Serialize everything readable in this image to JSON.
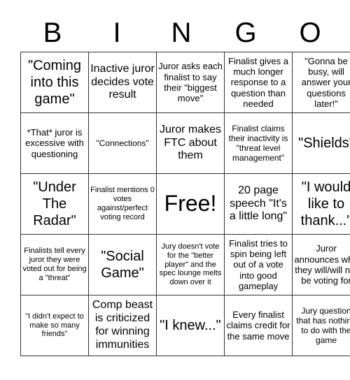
{
  "header": {
    "letters": [
      "B",
      "I",
      "N",
      "G",
      "O"
    ]
  },
  "cells": [
    [
      "\"Coming into this game\"",
      "Inactive juror decides vote result",
      "Juror asks each finalist to say their \"biggest move\"",
      "Finalist gives a much longer response to a question than needed",
      "\"Gonna be busy, will answer your questions later!\""
    ],
    [
      "*That* juror is excessive with questioning",
      "\"Connections\"",
      "Juror makes FTC about them",
      "Finalist claims their inactivity is \"threat level management\"",
      "\"Shields\""
    ],
    [
      "\"Under The Radar\"",
      "Finalist mentions 0 votes against/perfect voting record",
      "Free!",
      "20 page speech \"It's a little long\"",
      "\"I would like to thank...\""
    ],
    [
      "Finalists tell every juror they were voted out for being a \"threat\"",
      "\"Social Game\"",
      "Jury doesn't vote for the \"better player\" and the spec lounge melts down over it",
      "Finalist tries to spin being left out of a vote into good gameplay",
      "Juror announces who they will/will not be voting for"
    ],
    [
      "\"I didn't expect to make so many friends\"",
      "Comp beast is criticized for winning immunities",
      "\"I knew...\"",
      "Every finalist claims credit for the same move",
      "Jury question that has nothing to do with the game"
    ]
  ]
}
